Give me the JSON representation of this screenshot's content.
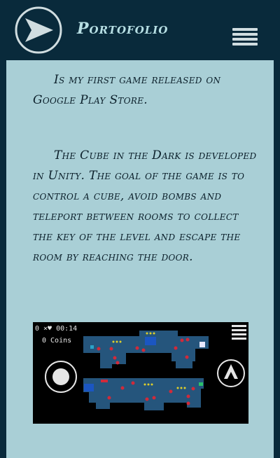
{
  "header": {
    "title": "Portofolio",
    "logo_icon": "play-arrow-circle-icon",
    "menu_icon": "hamburger-icon"
  },
  "content": {
    "paragraph_1": "Is my first game released on Google Play Store.",
    "paragraph_2": "The Cube in the Dark is developed in Unity. The goal of the game is to control a cube, avoid bombs and teleport between rooms to collect the key of the level and escape the room by reaching the door."
  },
  "game_screenshot": {
    "hud_top": "0 ×♥ 00:14",
    "coins_text": "0 Coins"
  },
  "colors": {
    "header_bg": "#092a3b",
    "content_bg": "#a9cfd6",
    "title_text": "#b7dfe4",
    "body_text": "#0b1f2a"
  }
}
